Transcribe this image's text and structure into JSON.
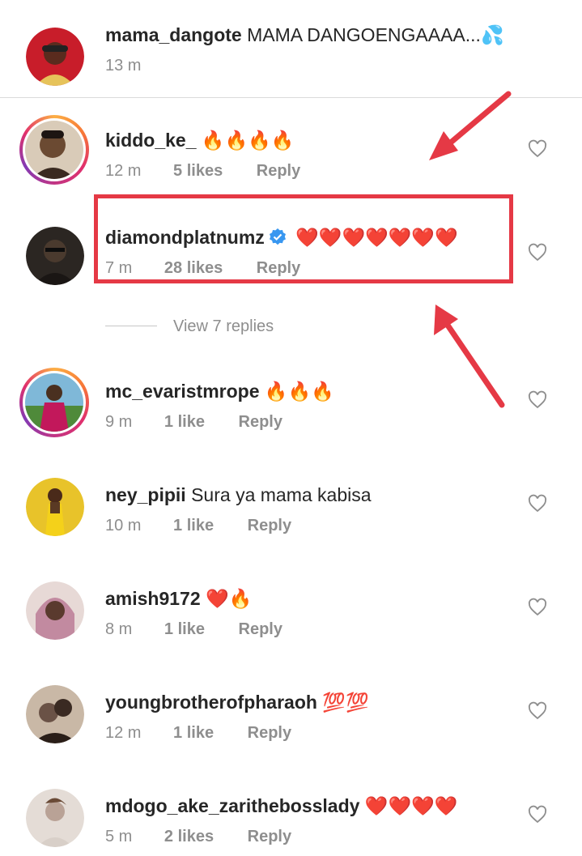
{
  "comments": [
    {
      "username": "mama_dangote",
      "text": "MAMA DANGOENGAAAA...💦",
      "time": "13 m",
      "likes": "",
      "reply": "",
      "ring": false,
      "avatar_color": "#c81d2a"
    },
    {
      "username": "kiddo_ke_",
      "text": "🔥🔥🔥🔥",
      "time": "12 m",
      "likes": "5 likes",
      "reply": "Reply",
      "ring": true,
      "avatar_color": "#6b4a32"
    },
    {
      "username": "diamondplatnumz",
      "text": "❤️❤️❤️❤️❤️❤️❤️",
      "time": "7 m",
      "likes": "28 likes",
      "reply": "Reply",
      "ring": false,
      "avatar_color": "#2b2622",
      "verified": true
    },
    {
      "username": "mc_evaristmrope",
      "text": "🔥🔥🔥",
      "time": "9 m",
      "likes": "1 like",
      "reply": "Reply",
      "ring": true,
      "avatar_color": "#c2185b"
    },
    {
      "username": "ney_pipii",
      "text": "Sura  ya mama kabisa",
      "time": "10 m",
      "likes": "1 like",
      "reply": "Reply",
      "ring": false,
      "avatar_color": "#e8c32a"
    },
    {
      "username": "amish9172",
      "text": "❤️🔥",
      "time": "8 m",
      "likes": "1 like",
      "reply": "Reply",
      "ring": false,
      "avatar_color": "#8a5a6a"
    },
    {
      "username": "youngbrotherofpharaoh",
      "text": "💯💯",
      "time": "12 m",
      "likes": "1 like",
      "reply": "Reply",
      "ring": false,
      "avatar_color": "#6a5246"
    },
    {
      "username": "mdogo_ake_zarithebosslady",
      "text": "❤️❤️❤️❤️",
      "time": "5 m",
      "likes": "2 likes",
      "reply": "Reply",
      "ring": false,
      "avatar_color": "#b9a296"
    }
  ],
  "view_replies": "View 7 replies",
  "colors": {
    "annotation_red": "#e53945",
    "verified_blue": "#3897f0",
    "meta_gray": "#8e8e8e"
  },
  "icons": {
    "heart": "heart-outline-icon",
    "verified": "verified-badge-icon"
  }
}
